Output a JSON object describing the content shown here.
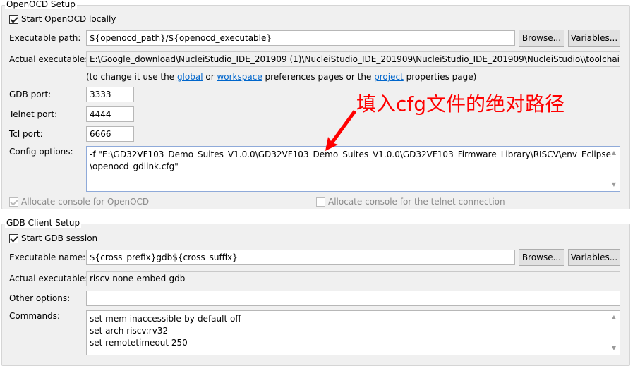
{
  "openocd": {
    "section_title": "OpenOCD Setup",
    "start_locally_label": "Start OpenOCD locally",
    "start_locally_checked": true,
    "executable_path_label": "Executable path:",
    "executable_path_value": "${openocd_path}/${openocd_executable}",
    "browse_label": "Browse...",
    "variables_label": "Variables...",
    "actual_executable_label": "Actual executable:",
    "actual_executable_value": "E:\\Google_download\\NucleiStudio_IDE_201909 (1)\\NucleiStudio_IDE_201909\\NucleiStudio_IDE_201909\\NucleiStudio\\\\toolchain\\Op",
    "hint_prefix": "(to change it use the ",
    "hint_global": "global",
    "hint_or": " or ",
    "hint_workspace": "workspace",
    "hint_middle": " preferences pages or the ",
    "hint_project": "project",
    "hint_suffix": " properties page)",
    "gdb_port_label": "GDB port:",
    "gdb_port_value": "3333",
    "telnet_port_label": "Telnet port:",
    "telnet_port_value": "4444",
    "tcl_port_label": "Tcl port:",
    "tcl_port_value": "6666",
    "config_options_label": "Config options:",
    "config_options_line1": "-f \"E:\\GD32VF103_Demo_Suites_V1.0.0\\GD32VF103_Demo_Suites_V1.0.0\\GD32VF103_Firmware_Library\\RISCV\\env_Eclipse",
    "config_options_line2": "\\openocd_gdlink.cfg\"",
    "allocate_console_label": "Allocate console for OpenOCD",
    "allocate_console_checked": true,
    "allocate_telnet_label": "Allocate console for the telnet connection",
    "allocate_telnet_checked": false
  },
  "gdb": {
    "section_title": "GDB Client Setup",
    "start_session_label": "Start GDB session",
    "start_session_checked": true,
    "executable_name_label": "Executable name:",
    "executable_name_value": "${cross_prefix}gdb${cross_suffix}",
    "browse_label": "Browse...",
    "variables_label": "Variables...",
    "actual_executable_label": "Actual executable:",
    "actual_executable_value": "riscv-none-embed-gdb",
    "other_options_label": "Other options:",
    "other_options_value": "",
    "commands_label": "Commands:",
    "commands_lines": [
      "set mem inaccessible-by-default off",
      "set arch riscv:rv32",
      "set remotetimeout 250"
    ]
  },
  "annotation": {
    "text": "填入cfg文件的绝对路径",
    "color": "#ff0000"
  }
}
